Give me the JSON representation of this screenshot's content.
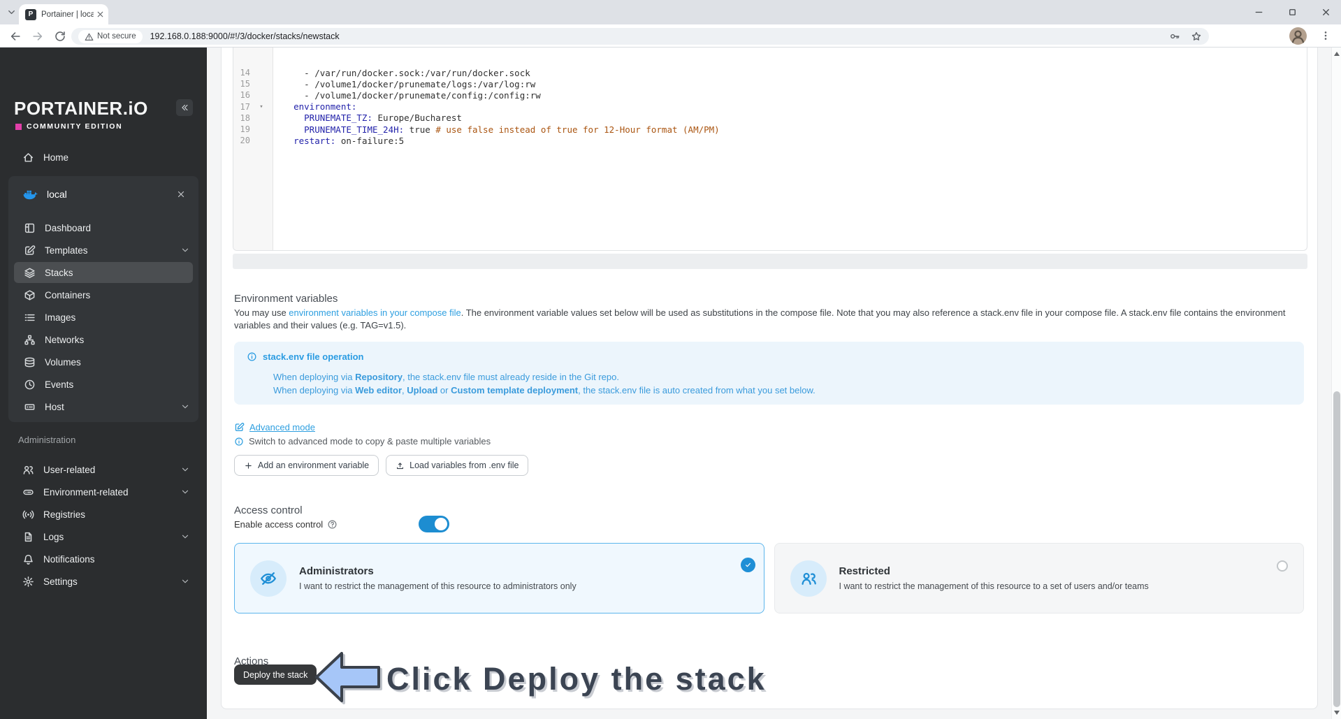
{
  "browser": {
    "tab_title": "Portainer | loca",
    "favicon_letter": "P",
    "not_secure_label": "Not secure",
    "url": "192.168.0.188:9000/#!/3/docker/stacks/newstack"
  },
  "sidebar": {
    "logo_text": "PORTAINER.iO",
    "edition_label": "COMMUNITY EDITION",
    "home_label": "Home",
    "environment": {
      "name": "local",
      "items": [
        {
          "label": "Dashboard",
          "icon": "dashboard-icon"
        },
        {
          "label": "Templates",
          "icon": "templates-icon",
          "chevron": true
        },
        {
          "label": "Stacks",
          "icon": "stacks-icon",
          "active": true
        },
        {
          "label": "Containers",
          "icon": "containers-icon"
        },
        {
          "label": "Images",
          "icon": "images-icon"
        },
        {
          "label": "Networks",
          "icon": "networks-icon"
        },
        {
          "label": "Volumes",
          "icon": "volumes-icon"
        },
        {
          "label": "Events",
          "icon": "events-icon"
        },
        {
          "label": "Host",
          "icon": "host-icon",
          "chevron": true
        }
      ]
    },
    "admin_label": "Administration",
    "admin_items": [
      {
        "label": "User-related",
        "icon": "users-icon",
        "chevron": true
      },
      {
        "label": "Environment-related",
        "icon": "environments-icon",
        "chevron": true
      },
      {
        "label": "Registries",
        "icon": "registries-icon"
      },
      {
        "label": "Logs",
        "icon": "logs-icon",
        "chevron": true
      },
      {
        "label": "Notifications",
        "icon": "notifications-icon"
      },
      {
        "label": "Settings",
        "icon": "settings-icon",
        "chevron": true
      }
    ]
  },
  "editor": {
    "lines": [
      {
        "num": "14",
        "tokens": [
          {
            "c": "pln",
            "t": "      - /var/run/docker.sock:/var/run/docker.sock"
          }
        ]
      },
      {
        "num": "15",
        "tokens": [
          {
            "c": "pln",
            "t": "      - /volume1/docker/prunemate/logs:/var/log:rw"
          }
        ]
      },
      {
        "num": "16",
        "tokens": [
          {
            "c": "pln",
            "t": "      - /volume1/docker/prunemate/config:/config:rw"
          }
        ]
      },
      {
        "num": "17",
        "fold": true,
        "tokens": [
          {
            "c": "key",
            "t": "    environment:"
          }
        ]
      },
      {
        "num": "18",
        "tokens": [
          {
            "c": "key",
            "t": "      PRUNEMATE_TZ:"
          },
          {
            "c": "pln",
            "t": " Europe/Bucharest"
          }
        ]
      },
      {
        "num": "19",
        "tokens": [
          {
            "c": "key",
            "t": "      PRUNEMATE_TIME_24H:"
          },
          {
            "c": "pln",
            "t": " true "
          },
          {
            "c": "com",
            "t": "# use false instead of true for 12-Hour format (AM/PM)"
          }
        ]
      },
      {
        "num": "20",
        "tokens": [
          {
            "c": "key",
            "t": "    restart:"
          },
          {
            "c": "pln",
            "t": " on-failure:5"
          }
        ]
      }
    ]
  },
  "env_vars": {
    "title": "Environment variables",
    "description_parts": [
      {
        "t": "You may use "
      },
      {
        "t": "environment variables in your compose file",
        "link": true
      },
      {
        "t": ". The environment variable values set below will be used as substitutions in the compose file. Note that you may also reference a stack.env file in your compose file. A stack.env file contains the environment variables and their values (e.g. TAG=v1.5)."
      }
    ],
    "info_box": {
      "title": "stack.env file operation",
      "lines": [
        [
          {
            "t": "When deploying via "
          },
          {
            "t": "Repository",
            "b": true
          },
          {
            "t": ", the stack.env file must already reside in the Git repo."
          }
        ],
        [
          {
            "t": "When deploying via "
          },
          {
            "t": "Web editor",
            "b": true
          },
          {
            "t": ", "
          },
          {
            "t": "Upload",
            "b": true
          },
          {
            "t": " or "
          },
          {
            "t": "Custom template deployment",
            "b": true
          },
          {
            "t": ", the stack.env file is auto created from what you set below."
          }
        ]
      ]
    },
    "advanced_mode_label": "Advanced mode",
    "advanced_mode_hint": "Switch to advanced mode to copy & paste multiple variables",
    "add_button": "Add an environment variable",
    "load_button": "Load variables from .env file"
  },
  "access_control": {
    "title": "Access control",
    "enable_label": "Enable access control",
    "options": [
      {
        "title": "Administrators",
        "description": "I want to restrict the management of this resource to administrators only",
        "icon": "eye-off-icon",
        "selected": true
      },
      {
        "title": "Restricted",
        "description": "I want to restrict the management of this resource to a set of users and/or teams",
        "icon": "team-icon",
        "selected": false
      }
    ]
  },
  "actions": {
    "title": "Actions",
    "deploy_button": "Deploy the stack"
  },
  "annotation": {
    "text": "Click Deploy the stack"
  },
  "colors": {
    "accent_blue": "#1d8dd1",
    "link_blue": "#2e9fe0",
    "docker_blue": "#2496ed",
    "edition_magenta": "#e23fa9",
    "arrow_fill": "#a6c6f8",
    "annotation_text": "#3b4452",
    "sidebar_bg": "#2b2d2f",
    "info_box_bg": "#ecf5fc",
    "comment_orange": "#aa5511",
    "yaml_key_blue": "#2222aa"
  }
}
